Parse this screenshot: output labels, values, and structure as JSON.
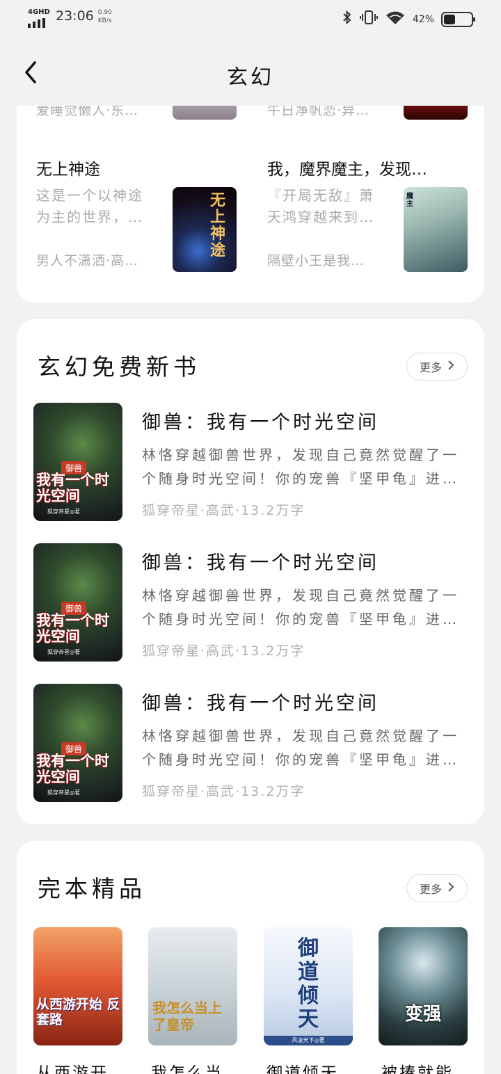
{
  "status_bar": {
    "network": "4GHD",
    "time": "23:06",
    "speed_value": "0.90",
    "speed_unit": "KB/s",
    "battery_pct": "42%",
    "battery_level": 0.42,
    "icons": [
      "bluetooth-icon",
      "vibrate-icon",
      "wifi-icon"
    ]
  },
  "header": {
    "title": "玄幻",
    "back_icon": "back-arrow-icon"
  },
  "top_grid": {
    "partial_row": [
      {
        "meta": "爱睡觉懒人·东…"
      },
      {
        "meta": "午日净帆恋·异…"
      }
    ],
    "books": [
      {
        "title": "无上神途",
        "desc": "这是一个以神途为主的世界，…",
        "meta": "男人不潇洒·高…",
        "cover_text": "无上神途"
      },
      {
        "title": "我，魔界魔主，发现…",
        "desc": "『开局无敌』萧天鸿穿越来到…",
        "meta": "隔壁小王是我…",
        "cover_text": "魔主"
      }
    ]
  },
  "free_new": {
    "title": "玄幻免费新书",
    "more_label": "更多",
    "items": [
      {
        "title": "御兽：我有一个时光空间",
        "desc": "林恪穿越御兽世界，发现自己竟然觉醒了一个随身时光空间！你的宠兽『坚甲龟』进…",
        "meta": "狐穿帝星·高武·13.2万字",
        "cover_tag": "御兽",
        "cover_big": "我有一个时光空间",
        "cover_author": "狐穿帝星◎著"
      },
      {
        "title": "御兽：我有一个时光空间",
        "desc": "林恪穿越御兽世界，发现自己竟然觉醒了一个随身时光空间！你的宠兽『坚甲龟』进…",
        "meta": "狐穿帝星·高武·13.2万字",
        "cover_tag": "御兽",
        "cover_big": "我有一个时光空间",
        "cover_author": "狐穿帝星◎著"
      },
      {
        "title": "御兽：我有一个时光空间",
        "desc": "林恪穿越御兽世界，发现自己竟然觉醒了一个随身时光空间！你的宠兽『坚甲龟』进…",
        "meta": "狐穿帝星·高武·13.2万字",
        "cover_tag": "御兽",
        "cover_big": "我有一个时光空间",
        "cover_author": "狐穿帝星◎著"
      }
    ]
  },
  "completed": {
    "title": "完本精品",
    "more_label": "更多",
    "books": [
      {
        "title": "从西游开…",
        "cover_big": "从西游开始 反套路"
      },
      {
        "title": "我怎么当…",
        "cover_big": "我怎么当上了皇帝"
      },
      {
        "title": "御道倾天",
        "cover_big": "御道倾天",
        "cover_author": "风凌天下◎著"
      },
      {
        "title": "被揍就能…",
        "cover_big": "变强"
      }
    ]
  }
}
